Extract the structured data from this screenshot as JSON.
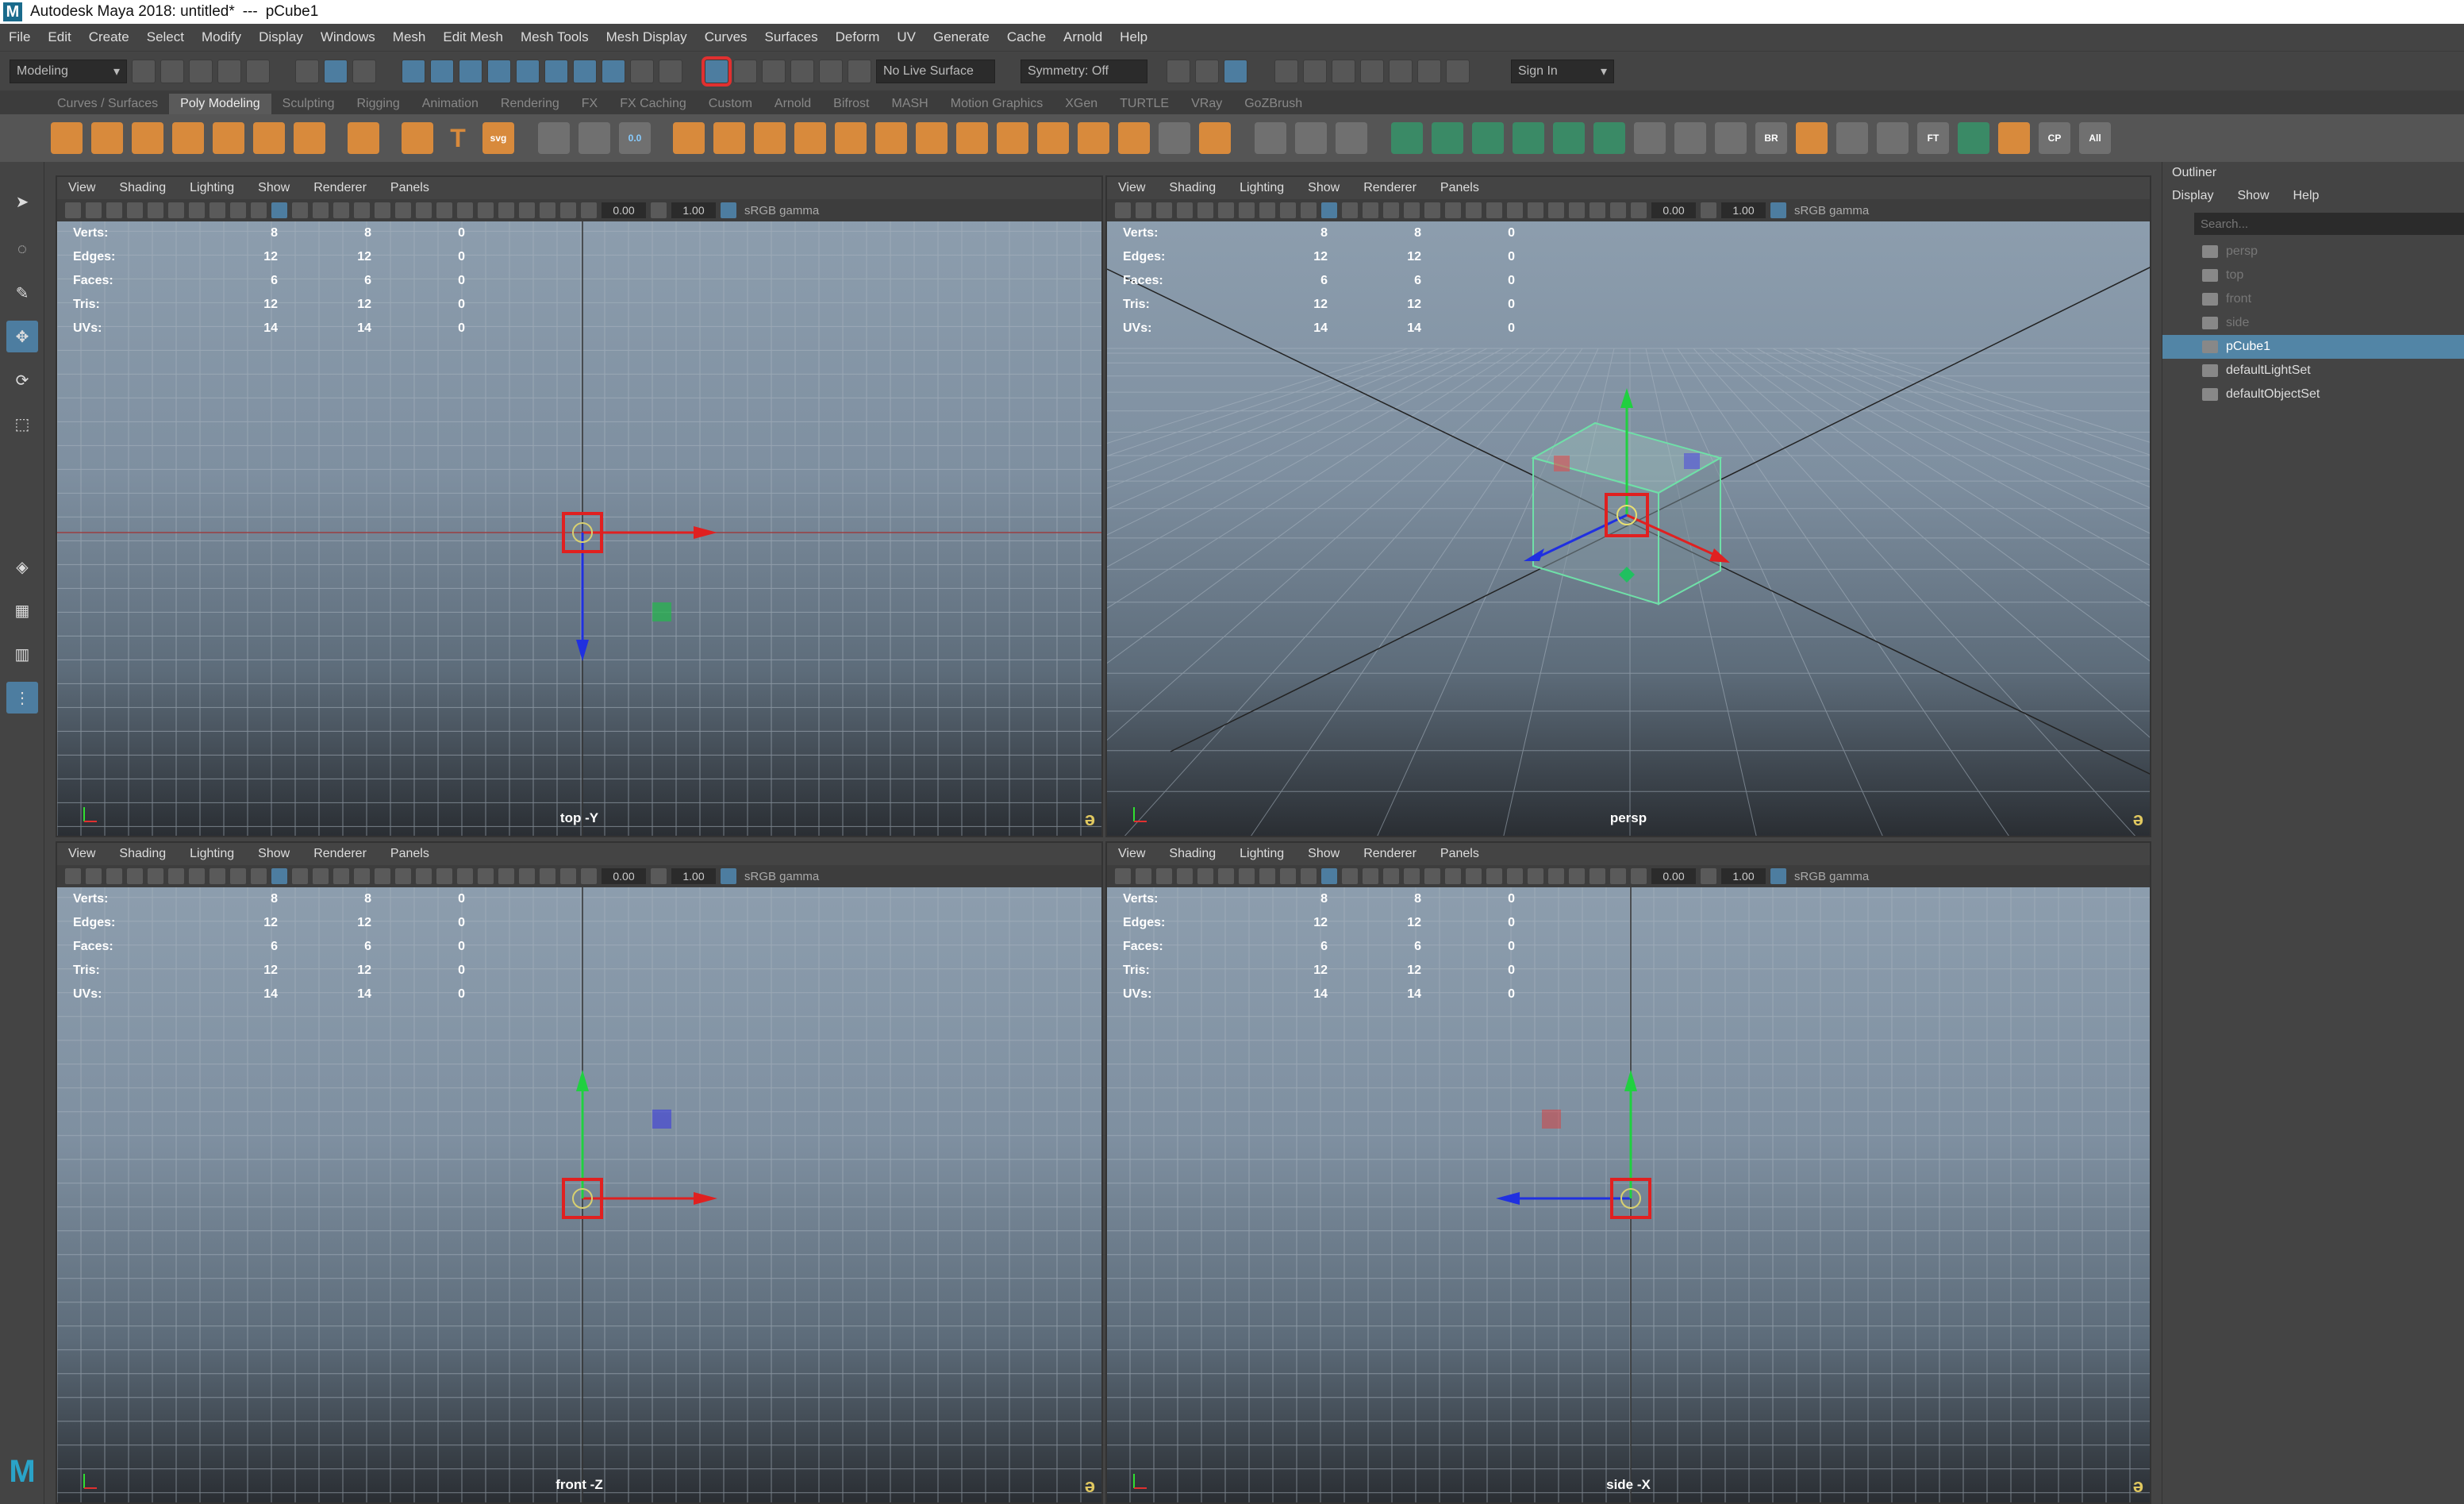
{
  "window": {
    "title": "Autodesk Maya 2018: untitled*",
    "separator": "---",
    "selection": "pCube1"
  },
  "menus": [
    "File",
    "Edit",
    "Create",
    "Select",
    "Modify",
    "Display",
    "Windows",
    "Mesh",
    "Edit Mesh",
    "Mesh Tools",
    "Mesh Display",
    "Curves",
    "Surfaces",
    "Deform",
    "UV",
    "Generate",
    "Cache",
    "Arnold",
    "Help"
  ],
  "statusline": {
    "menuset": "Modeling",
    "live_surface": "No Live Surface",
    "symmetry": "Symmetry: Off",
    "sign_in": "Sign In"
  },
  "shelf_tabs": [
    "Curves / Surfaces",
    "Poly Modeling",
    "Sculpting",
    "Rigging",
    "Animation",
    "Rendering",
    "FX",
    "FX Caching",
    "Custom",
    "Arnold",
    "Bifrost",
    "MASH",
    "Motion Graphics",
    "XGen",
    "TURTLE",
    "VRay",
    "GoZBrush"
  ],
  "active_shelf_tab": "Poly Modeling",
  "shelf_text_icons": {
    "text": "T",
    "svg": "svg",
    "val": "0.0",
    "br": "BR",
    "ft": "FT",
    "cp": "CP",
    "all": "All"
  },
  "viewport_menu": [
    "View",
    "Shading",
    "Lighting",
    "Show",
    "Renderer",
    "Panels"
  ],
  "viewport_fields": {
    "exposure": "0.00",
    "gamma": "1.00",
    "colorspace": "sRGB gamma"
  },
  "hud": {
    "labels": [
      "Verts:",
      "Edges:",
      "Faces:",
      "Tris:",
      "UVs:"
    ],
    "rows": [
      [
        "8",
        "8",
        "0"
      ],
      [
        "12",
        "12",
        "0"
      ],
      [
        "6",
        "6",
        "0"
      ],
      [
        "12",
        "12",
        "0"
      ],
      [
        "14",
        "14",
        "0"
      ]
    ]
  },
  "viewports": [
    {
      "label": "top -Y"
    },
    {
      "label": "persp"
    },
    {
      "label": "front -Z"
    },
    {
      "label": "side -X"
    }
  ],
  "outliner": {
    "title": "Outliner",
    "menu": [
      "Display",
      "Show",
      "Help"
    ],
    "search_placeholder": "Search...",
    "items": [
      {
        "name": "persp",
        "state": "dim"
      },
      {
        "name": "top",
        "state": "dim"
      },
      {
        "name": "front",
        "state": "dim"
      },
      {
        "name": "side",
        "state": "dim"
      },
      {
        "name": "pCube1",
        "state": "selected"
      },
      {
        "name": "defaultLightSet",
        "state": "normal"
      },
      {
        "name": "defaultObjectSet",
        "state": "normal"
      }
    ]
  },
  "colors": {
    "accent": "#4d7da0",
    "selection": "#5285a6",
    "highlight": "#e03030",
    "shelf_orange": "#d88a3c",
    "shelf_green": "#3a8a66"
  }
}
